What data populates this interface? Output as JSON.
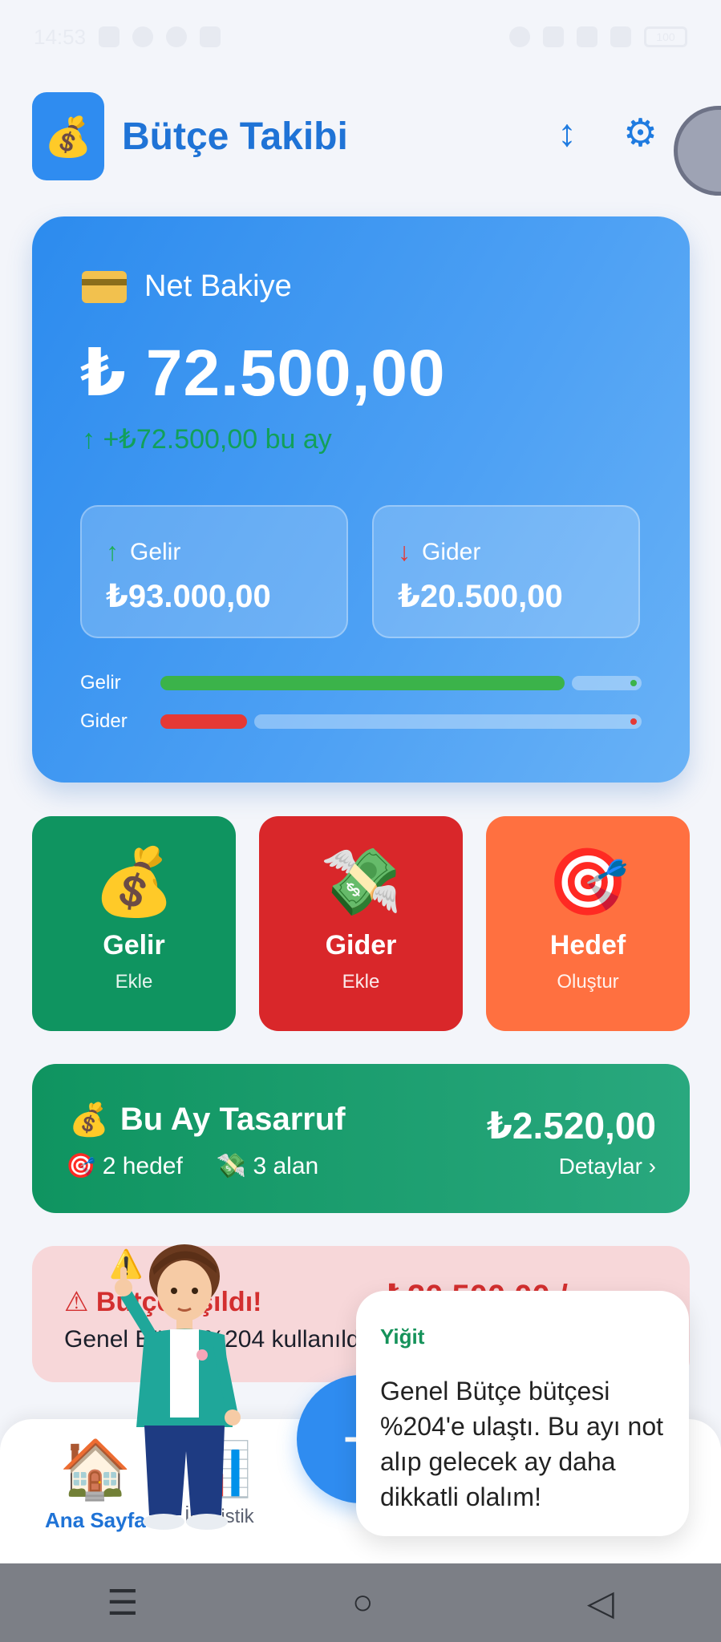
{
  "status_bar": {
    "time": "14:53",
    "battery": "100"
  },
  "header": {
    "logo_icon": "money-bag-icon",
    "title": "Bütçe Takibi",
    "sort_icon": "sort-arrows-icon",
    "settings_icon": "gear-icon"
  },
  "balance": {
    "label": "Net Bakiye",
    "amount": "₺ 72.500,00",
    "change": "↑ +₺72.500,00 bu ay",
    "income_label": "Gelir",
    "income_value": "₺93.000,00",
    "expense_label": "Gider",
    "expense_value": "₺20.500,00",
    "bar_income_label": "Gelir",
    "bar_expense_label": "Gider",
    "income_fraction": 0.84,
    "expense_fraction": 0.18,
    "colors": {
      "income": "#3bb34a",
      "expense": "#e53935"
    }
  },
  "actions": [
    {
      "icon": "💰",
      "title": "Gelir",
      "subtitle": "Ekle"
    },
    {
      "icon": "💸",
      "title": "Gider",
      "subtitle": "Ekle"
    },
    {
      "icon": "🎯",
      "title": "Hedef",
      "subtitle": "Oluştur"
    }
  ],
  "savings": {
    "title": "Bu Ay Tasarruf",
    "goals": "🎯 2 hedef",
    "areas": "💸 3 alan",
    "amount": "₺2.520,00",
    "details": "Detaylar ›"
  },
  "alert": {
    "title": "⚠ Bütçe Aşıldı!",
    "text": "Genel Bütçe %204 kullanıldı",
    "amount": "₺20.500,00 /"
  },
  "bottom_nav": {
    "home_label": "Ana Sayfa",
    "stats_label": "İstatistik",
    "fab_label": "+"
  },
  "assistant": {
    "name": "Yiğit",
    "message": "Genel Bütçe bütçesi %204'e ulaştı. Bu ayı not alıp gelecek ay daha dikkatli olalım!"
  }
}
